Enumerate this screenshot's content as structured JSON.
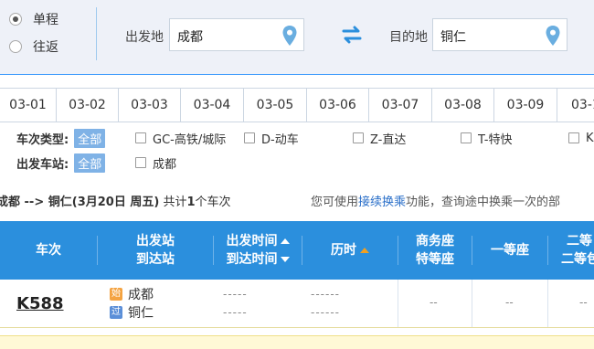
{
  "search": {
    "trip_types": [
      {
        "label": "单程",
        "checked": true
      },
      {
        "label": "往返",
        "checked": false
      }
    ],
    "from_label": "出发地",
    "from_value": "成都",
    "to_label": "目的地",
    "to_value": "铜仁",
    "icons": {
      "location": "map-pin-icon",
      "swap": "swap-arrows-icon"
    },
    "accent_color": "#6aaee0"
  },
  "dates": [
    "03-01",
    "03-02",
    "03-03",
    "03-04",
    "03-05",
    "03-06",
    "03-07",
    "03-08",
    "03-09",
    "03-1"
  ],
  "filters": {
    "train_type_label": "车次类型:",
    "all_label": "全部",
    "train_types": [
      "GC-高铁/城际",
      "D-动车",
      "Z-直达",
      "T-特快",
      "K"
    ],
    "station_label": "出发车站:",
    "station_all_label": "全部",
    "stations": [
      "成都"
    ]
  },
  "summary": {
    "route": "成都 --> 铜仁",
    "date": "(3月20日 周五)",
    "count_prefix": "共计",
    "count": "1",
    "count_suffix": "个车次",
    "hint_prefix": "您可使用",
    "hint_link": "接续换乘",
    "hint_suffix": "功能，查询途中换乘一次的部"
  },
  "table": {
    "headers": {
      "train": "车次",
      "stations_top": "出发站",
      "stations_bottom": "到达站",
      "time_top": "出发时间",
      "time_bottom": "到达时间",
      "duration": "历时",
      "business_top": "商务座",
      "business_bottom": "特等座",
      "first": "一等座",
      "second_top": "二等",
      "second_bottom": "二等包"
    },
    "header_color": "#2b8fdd",
    "rows": [
      {
        "train_no": "K588",
        "from_badge": "始",
        "from": "成都",
        "to_badge": "过",
        "to": "铜仁",
        "depart": "-----",
        "arrive": "-----",
        "duration_top": "------",
        "duration_bottom": "------",
        "business": "--",
        "first": "--",
        "second": "--"
      }
    ]
  }
}
